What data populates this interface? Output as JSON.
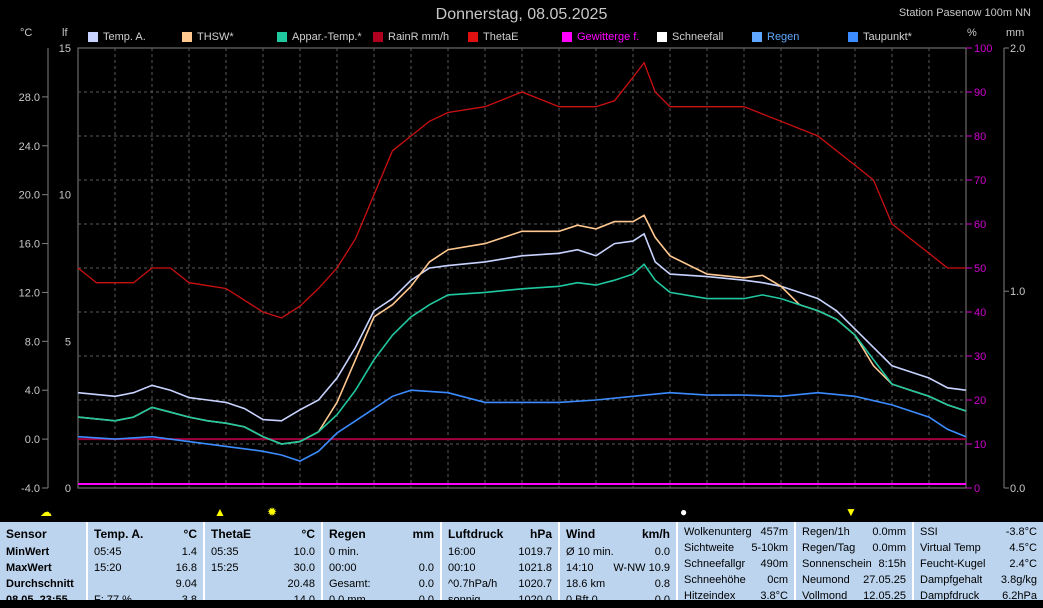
{
  "header": {
    "title": "Donnerstag, 08.05.2025",
    "station": "Station Pasenow 100m NN",
    "unit_left": "°C",
    "unit_left2": "lf",
    "unit_right": "%",
    "unit_right2": "mm"
  },
  "legend": [
    {
      "label": "Temp. A.",
      "color": "#c8d4ff"
    },
    {
      "label": "THSW*",
      "color": "#ffc890"
    },
    {
      "label": "Appar.-Temp.*",
      "color": "#20c8a0"
    },
    {
      "label": "RainR mm/h",
      "color": "#b00020"
    },
    {
      "label": "ThetaE",
      "color": "#e01010"
    },
    {
      "label": "Gewitterge f.",
      "color": "#ff00ff"
    },
    {
      "label": "Schneefall",
      "color": "#ffffff"
    },
    {
      "label": "Regen",
      "color": "#60a8ff"
    },
    {
      "label": "Taupunkt*",
      "color": "#3c8cff"
    }
  ],
  "chart_data": {
    "type": "line",
    "x_hours": [
      0,
      24
    ],
    "axes": {
      "temp_ticks": [
        "28.0",
        "24.0",
        "20.0",
        "16.0",
        "12.0",
        "8.0",
        "4.0",
        "0.0",
        "-4.0"
      ],
      "temp_range": [
        -4,
        32
      ],
      "lf_ticks": [
        "15",
        "10",
        "5",
        "0"
      ],
      "percent_ticks": [
        "100",
        "90",
        "80",
        "70",
        "60",
        "50",
        "40",
        "30",
        "20",
        "10",
        "0"
      ],
      "mm_ticks": [
        "2.0",
        "1.0",
        "0.0"
      ]
    },
    "series": [
      {
        "name": "Temp. A.",
        "color": "#c8d4ff",
        "points": [
          [
            0,
            3.8
          ],
          [
            1,
            3.5
          ],
          [
            1.5,
            3.8
          ],
          [
            2,
            4.4
          ],
          [
            2.5,
            4.0
          ],
          [
            3,
            3.4
          ],
          [
            3.5,
            3.2
          ],
          [
            4,
            3.0
          ],
          [
            4.5,
            2.5
          ],
          [
            5,
            1.6
          ],
          [
            5.5,
            1.5
          ],
          [
            6,
            2.4
          ],
          [
            6.5,
            3.2
          ],
          [
            7,
            5.0
          ],
          [
            7.5,
            7.5
          ],
          [
            8,
            10.5
          ],
          [
            8.5,
            11.5
          ],
          [
            9,
            13.0
          ],
          [
            9.5,
            14.0
          ],
          [
            10,
            14.2
          ],
          [
            11,
            14.5
          ],
          [
            12,
            15.0
          ],
          [
            13,
            15.2
          ],
          [
            13.5,
            15.5
          ],
          [
            14,
            15.0
          ],
          [
            14.5,
            16.0
          ],
          [
            15,
            16.2
          ],
          [
            15.3,
            16.8
          ],
          [
            15.6,
            14.5
          ],
          [
            16,
            13.5
          ],
          [
            17,
            13.3
          ],
          [
            18,
            13.0
          ],
          [
            18.5,
            12.8
          ],
          [
            19,
            12.5
          ],
          [
            19.5,
            12.0
          ],
          [
            20,
            11.5
          ],
          [
            20.5,
            10.5
          ],
          [
            21,
            9.0
          ],
          [
            21.5,
            7.5
          ],
          [
            22,
            6.0
          ],
          [
            22.5,
            5.5
          ],
          [
            23,
            5.0
          ],
          [
            23.5,
            4.2
          ],
          [
            24,
            4.0
          ]
        ]
      },
      {
        "name": "THSW*",
        "color": "#ffc890",
        "points": [
          [
            0,
            1.8
          ],
          [
            1,
            1.5
          ],
          [
            1.5,
            1.8
          ],
          [
            2,
            2.6
          ],
          [
            2.5,
            2.2
          ],
          [
            3,
            1.8
          ],
          [
            3.5,
            1.5
          ],
          [
            4,
            1.3
          ],
          [
            4.5,
            1.0
          ],
          [
            5,
            0.2
          ],
          [
            5.5,
            -0.4
          ],
          [
            6,
            -0.2
          ],
          [
            6.5,
            0.6
          ],
          [
            7,
            3.0
          ],
          [
            7.5,
            6.5
          ],
          [
            8,
            10.0
          ],
          [
            8.5,
            11.0
          ],
          [
            9,
            12.5
          ],
          [
            9.5,
            14.5
          ],
          [
            10,
            15.5
          ],
          [
            11,
            16.0
          ],
          [
            12,
            17.0
          ],
          [
            13,
            17.0
          ],
          [
            13.5,
            17.5
          ],
          [
            14,
            17.2
          ],
          [
            14.5,
            17.8
          ],
          [
            15,
            17.8
          ],
          [
            15.3,
            18.3
          ],
          [
            15.6,
            16.5
          ],
          [
            16,
            15.0
          ],
          [
            17,
            13.5
          ],
          [
            18,
            13.2
          ],
          [
            18.5,
            13.4
          ],
          [
            19,
            12.5
          ],
          [
            19.5,
            11.0
          ],
          [
            20,
            10.5
          ],
          [
            20.5,
            9.8
          ],
          [
            21,
            8.5
          ],
          [
            21.5,
            6.0
          ],
          [
            22,
            4.5
          ],
          [
            22.5,
            4.0
          ],
          [
            23,
            3.5
          ],
          [
            23.5,
            2.8
          ],
          [
            24,
            2.3
          ]
        ]
      },
      {
        "name": "Appar.-Temp.*",
        "color": "#20c8a0",
        "points": [
          [
            0,
            1.8
          ],
          [
            1,
            1.5
          ],
          [
            1.5,
            1.8
          ],
          [
            2,
            2.6
          ],
          [
            2.5,
            2.2
          ],
          [
            3,
            1.8
          ],
          [
            3.5,
            1.5
          ],
          [
            4,
            1.3
          ],
          [
            4.5,
            1.0
          ],
          [
            5,
            0.2
          ],
          [
            5.5,
            -0.4
          ],
          [
            6,
            -0.2
          ],
          [
            6.5,
            0.6
          ],
          [
            7,
            2.0
          ],
          [
            7.5,
            4.0
          ],
          [
            8,
            6.5
          ],
          [
            8.5,
            8.5
          ],
          [
            9,
            10.0
          ],
          [
            9.5,
            11.0
          ],
          [
            10,
            11.8
          ],
          [
            11,
            12.0
          ],
          [
            12,
            12.3
          ],
          [
            13,
            12.5
          ],
          [
            13.5,
            12.8
          ],
          [
            14,
            12.6
          ],
          [
            14.5,
            13.0
          ],
          [
            15,
            13.5
          ],
          [
            15.3,
            14.3
          ],
          [
            15.6,
            13.0
          ],
          [
            16,
            12.0
          ],
          [
            17,
            11.5
          ],
          [
            18,
            11.5
          ],
          [
            18.5,
            11.8
          ],
          [
            19,
            11.5
          ],
          [
            19.5,
            11.0
          ],
          [
            20,
            10.5
          ],
          [
            20.5,
            9.8
          ],
          [
            21,
            8.5
          ],
          [
            21.5,
            6.5
          ],
          [
            22,
            4.5
          ],
          [
            22.5,
            4.0
          ],
          [
            23,
            3.5
          ],
          [
            23.5,
            2.8
          ],
          [
            24,
            2.3
          ]
        ]
      },
      {
        "name": "Taupunkt*",
        "color": "#3c8cff",
        "points": [
          [
            0,
            0.2
          ],
          [
            1,
            0.0
          ],
          [
            2,
            0.2
          ],
          [
            3,
            -0.2
          ],
          [
            4,
            -0.6
          ],
          [
            5,
            -1.0
          ],
          [
            5.5,
            -1.3
          ],
          [
            6,
            -1.8
          ],
          [
            6.5,
            -1.0
          ],
          [
            7,
            0.5
          ],
          [
            7.5,
            1.5
          ],
          [
            8,
            2.5
          ],
          [
            8.5,
            3.5
          ],
          [
            9,
            4.0
          ],
          [
            10,
            3.8
          ],
          [
            11,
            3.0
          ],
          [
            12,
            3.0
          ],
          [
            13,
            3.0
          ],
          [
            14,
            3.2
          ],
          [
            15,
            3.5
          ],
          [
            16,
            3.8
          ],
          [
            17,
            3.6
          ],
          [
            18,
            3.6
          ],
          [
            19,
            3.5
          ],
          [
            20,
            3.8
          ],
          [
            21,
            3.5
          ],
          [
            22,
            2.8
          ],
          [
            23,
            1.8
          ],
          [
            23.5,
            0.8
          ],
          [
            24,
            0.2
          ]
        ]
      },
      {
        "name": "ThetaE",
        "color": "#cc1010",
        "axis": "lf",
        "points": [
          [
            0,
            7.5
          ],
          [
            0.5,
            7.0
          ],
          [
            1.5,
            7.0
          ],
          [
            2,
            7.5
          ],
          [
            2.5,
            7.5
          ],
          [
            3,
            7.0
          ],
          [
            4,
            6.8
          ],
          [
            5,
            6.0
          ],
          [
            5.5,
            5.8
          ],
          [
            6,
            6.2
          ],
          [
            6.5,
            6.8
          ],
          [
            7,
            7.5
          ],
          [
            7.5,
            8.5
          ],
          [
            8,
            10.0
          ],
          [
            8.5,
            11.5
          ],
          [
            9,
            12.0
          ],
          [
            9.5,
            12.5
          ],
          [
            10,
            12.8
          ],
          [
            11,
            13.0
          ],
          [
            12,
            13.5
          ],
          [
            13,
            13.0
          ],
          [
            14,
            13.0
          ],
          [
            14.5,
            13.2
          ],
          [
            15,
            14.0
          ],
          [
            15.3,
            14.5
          ],
          [
            15.6,
            13.5
          ],
          [
            16,
            13.0
          ],
          [
            17,
            13.0
          ],
          [
            18,
            13.0
          ],
          [
            19,
            12.5
          ],
          [
            20,
            12.0
          ],
          [
            20.5,
            11.5
          ],
          [
            21,
            11.0
          ],
          [
            21.5,
            10.5
          ],
          [
            22,
            9.0
          ],
          [
            22.5,
            8.5
          ],
          [
            23,
            8.0
          ],
          [
            23.5,
            7.5
          ],
          [
            24,
            7.5
          ]
        ]
      }
    ]
  },
  "icons": [
    {
      "name": "sun-cloud-icon",
      "glyph": "☁"
    },
    {
      "name": "sunrise-icon",
      "glyph": "▲"
    },
    {
      "name": "sun-icon",
      "glyph": "✹"
    },
    {
      "name": "moon-icon",
      "glyph": "●"
    },
    {
      "name": "moonset-icon",
      "glyph": "▼"
    }
  ],
  "table": {
    "sensor": {
      "header": "Sensor",
      "rows": [
        "MinWert",
        "MaxWert",
        "Durchschnitt",
        "08.05. 23:55"
      ]
    },
    "temp": {
      "header": "Temp. A.",
      "unit": "°C",
      "rows": [
        [
          "05:45",
          "1.4"
        ],
        [
          "15:20",
          "16.8"
        ],
        [
          "",
          "9.04"
        ],
        [
          "F: 77 %",
          "3.8"
        ]
      ]
    },
    "thetae": {
      "header": "ThetaE",
      "unit": "°C",
      "rows": [
        [
          "05:35",
          "10.0"
        ],
        [
          "15:25",
          "30.0"
        ],
        [
          "",
          "20.48"
        ],
        [
          "",
          "14.0"
        ]
      ]
    },
    "regen": {
      "header": "Regen",
      "unit": "mm",
      "rows": [
        [
          "0 min.",
          ""
        ],
        [
          "00:00",
          "0.0"
        ],
        [
          "Gesamt:",
          "0.0"
        ],
        [
          "0.0 mm",
          "0.0"
        ]
      ]
    },
    "luftdruck": {
      "header": "Luftdruck",
      "unit": "hPa",
      "rows": [
        [
          "16:00",
          "1019.7"
        ],
        [
          "00:10",
          "1021.8"
        ],
        [
          "^0.7hPa/h",
          "1020.7"
        ],
        [
          "sonnig",
          "1020.0"
        ]
      ]
    },
    "wind": {
      "header": "Wind",
      "unit": "km/h",
      "rows": [
        [
          "Ø 10 min.",
          "0.0"
        ],
        [
          "14:10",
          "W-NW 10.9"
        ],
        [
          "18.6 km",
          "0.8"
        ],
        [
          "0 Bft 0",
          "0.0"
        ]
      ]
    },
    "wolken": {
      "rows": [
        [
          "Wolkenunterg",
          "457m"
        ],
        [
          "Sichtweite",
          "5-10km"
        ],
        [
          "Schneefallgr",
          "490m"
        ],
        [
          "Schneehöhe",
          "0cm"
        ],
        [
          "Hitzeindex",
          "3.8°C"
        ]
      ]
    },
    "rain": {
      "rows": [
        [
          "Regen/1h",
          "0.0mm"
        ],
        [
          "Regen/Tag",
          "0.0mm"
        ],
        [
          "Sonnenschein",
          "8:15h"
        ],
        [
          "Neumond",
          "27.05.25"
        ],
        [
          "Vollmond",
          "12.05.25"
        ]
      ]
    },
    "ssi": {
      "rows": [
        [
          "SSI",
          "-3.8°C"
        ],
        [
          "Virtual Temp",
          "4.5°C"
        ],
        [
          "Feucht-Kugel",
          "2.4°C"
        ],
        [
          "Dampfgehalt",
          "3.8g/kg"
        ],
        [
          "Dampfdruck",
          "6.2hPa"
        ]
      ]
    }
  }
}
